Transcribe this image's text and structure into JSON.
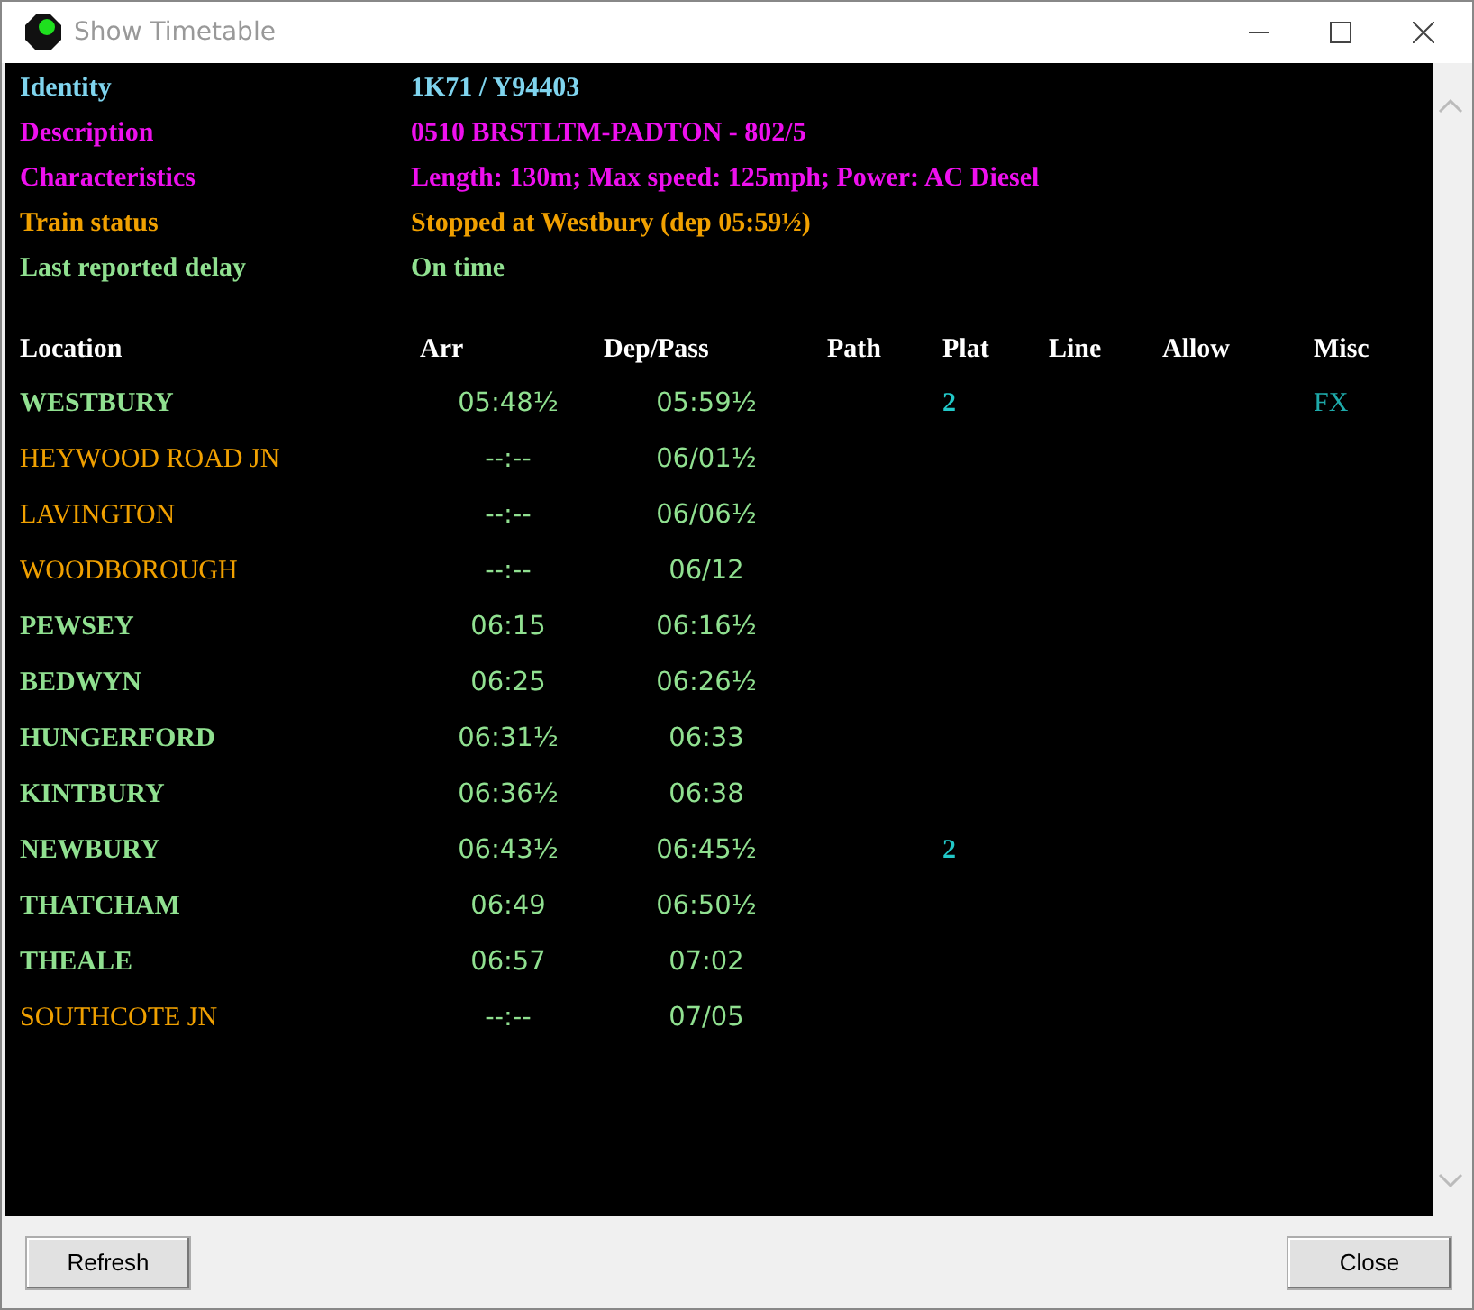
{
  "window": {
    "title": "Show Timetable"
  },
  "details": [
    {
      "label": "Identity",
      "value": "1K71 / Y94403",
      "color": "#7fd4ee"
    },
    {
      "label": "Description",
      "value": "0510 BRSTLTM-PADTON - 802/5",
      "color": "#ee10ee"
    },
    {
      "label": "Characteristics",
      "value": "Length: 130m; Max speed: 125mph; Power: AC Diesel",
      "color": "#ee10ee"
    },
    {
      "label": "Train status",
      "value": "Stopped at Westbury (dep 05:59½)",
      "color": "#f0a000"
    },
    {
      "label": "Last reported delay",
      "value": "On time",
      "color": "#90e090"
    }
  ],
  "timetable": {
    "columns": [
      "Location",
      "Arr",
      "Dep/Pass",
      "Path",
      "Plat",
      "Line",
      "Allow",
      "Misc"
    ],
    "rows": [
      {
        "kind": "stop",
        "location": "WESTBURY",
        "arr": "05:48½",
        "dep": "05:59½",
        "plat": "2",
        "misc": "FX"
      },
      {
        "kind": "pass",
        "location": "HEYWOOD ROAD JN",
        "arr": "--:--",
        "dep": "06/01½"
      },
      {
        "kind": "pass",
        "location": "LAVINGTON",
        "arr": "--:--",
        "dep": "06/06½"
      },
      {
        "kind": "pass",
        "location": "WOODBOROUGH",
        "arr": "--:--",
        "dep": "06/12"
      },
      {
        "kind": "stop",
        "location": "PEWSEY",
        "arr": "06:15",
        "dep": "06:16½"
      },
      {
        "kind": "stop",
        "location": "BEDWYN",
        "arr": "06:25",
        "dep": "06:26½"
      },
      {
        "kind": "stop",
        "location": "HUNGERFORD",
        "arr": "06:31½",
        "dep": "06:33"
      },
      {
        "kind": "stop",
        "location": "KINTBURY",
        "arr": "06:36½",
        "dep": "06:38"
      },
      {
        "kind": "stop",
        "location": "NEWBURY",
        "arr": "06:43½",
        "dep": "06:45½",
        "plat": "2"
      },
      {
        "kind": "stop",
        "location": "THATCHAM",
        "arr": "06:49",
        "dep": "06:50½"
      },
      {
        "kind": "stop",
        "location": "THEALE",
        "arr": "06:57",
        "dep": "07:02"
      },
      {
        "kind": "pass",
        "location": "SOUTHCOTE JN",
        "arr": "--:--",
        "dep": "07/05"
      }
    ]
  },
  "buttons": [
    {
      "label": "Refresh"
    },
    {
      "label": "Close"
    }
  ]
}
